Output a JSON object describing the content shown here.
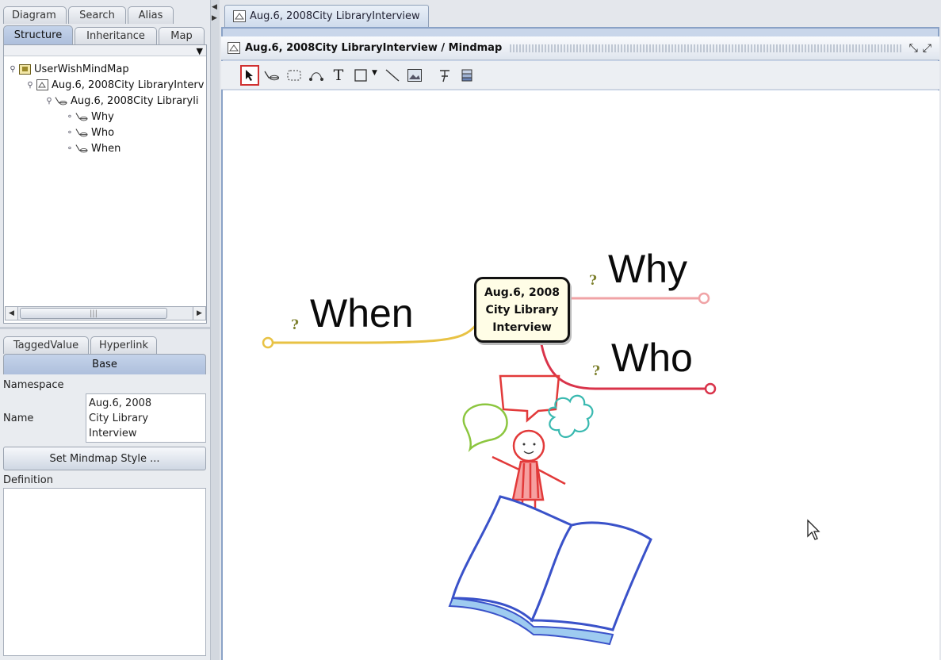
{
  "left_panel": {
    "tabs_top": [
      "Diagram",
      "Search",
      "Alias"
    ],
    "tabs_bottom": [
      "Structure",
      "Inheritance",
      "Map"
    ],
    "tree": [
      {
        "label": "UserWishMindMap"
      },
      {
        "label": "Aug.6, 2008City LibraryInterv"
      },
      {
        "label": "Aug.6, 2008City Libraryli"
      },
      {
        "label": "Why"
      },
      {
        "label": "Who"
      },
      {
        "label": "When"
      }
    ],
    "scroll_thumb": "|||"
  },
  "props_panel": {
    "tabs": [
      "TaggedValue",
      "Hyperlink"
    ],
    "base_tab": "Base",
    "namespace_label": "Namespace",
    "name_label": "Name",
    "name_value": [
      "Aug.6, 2008",
      "City Library",
      "Interview"
    ],
    "set_style_button": "Set Mindmap Style ...",
    "definition_label": "Definition"
  },
  "editor": {
    "doc_tab": "Aug.6, 2008City LibraryInterview",
    "title": "Aug.6, 2008City LibraryInterview / Mindmap",
    "toolbar_tools": [
      "select",
      "topic",
      "boundary",
      "relation",
      "text",
      "rectangle",
      "line",
      "image",
      "pin",
      "layer"
    ],
    "text_tool_glyph": "T"
  },
  "mindmap": {
    "central_topic": [
      "Aug.6, 2008",
      "City Library",
      "Interview"
    ],
    "topics": [
      {
        "label": "When",
        "color": "#e8c244"
      },
      {
        "label": "Why",
        "color": "#f0a3a6"
      },
      {
        "label": "Who",
        "color": "#d9334a"
      }
    ],
    "question_mark": "?"
  },
  "colors": {
    "accent": "#8aa2c6",
    "selected_tool": "#d03030",
    "book": "#3a52c9",
    "girl": "#e23a3a",
    "bubble_green": "#8cc63f",
    "bubble_teal": "#39b9b0"
  }
}
